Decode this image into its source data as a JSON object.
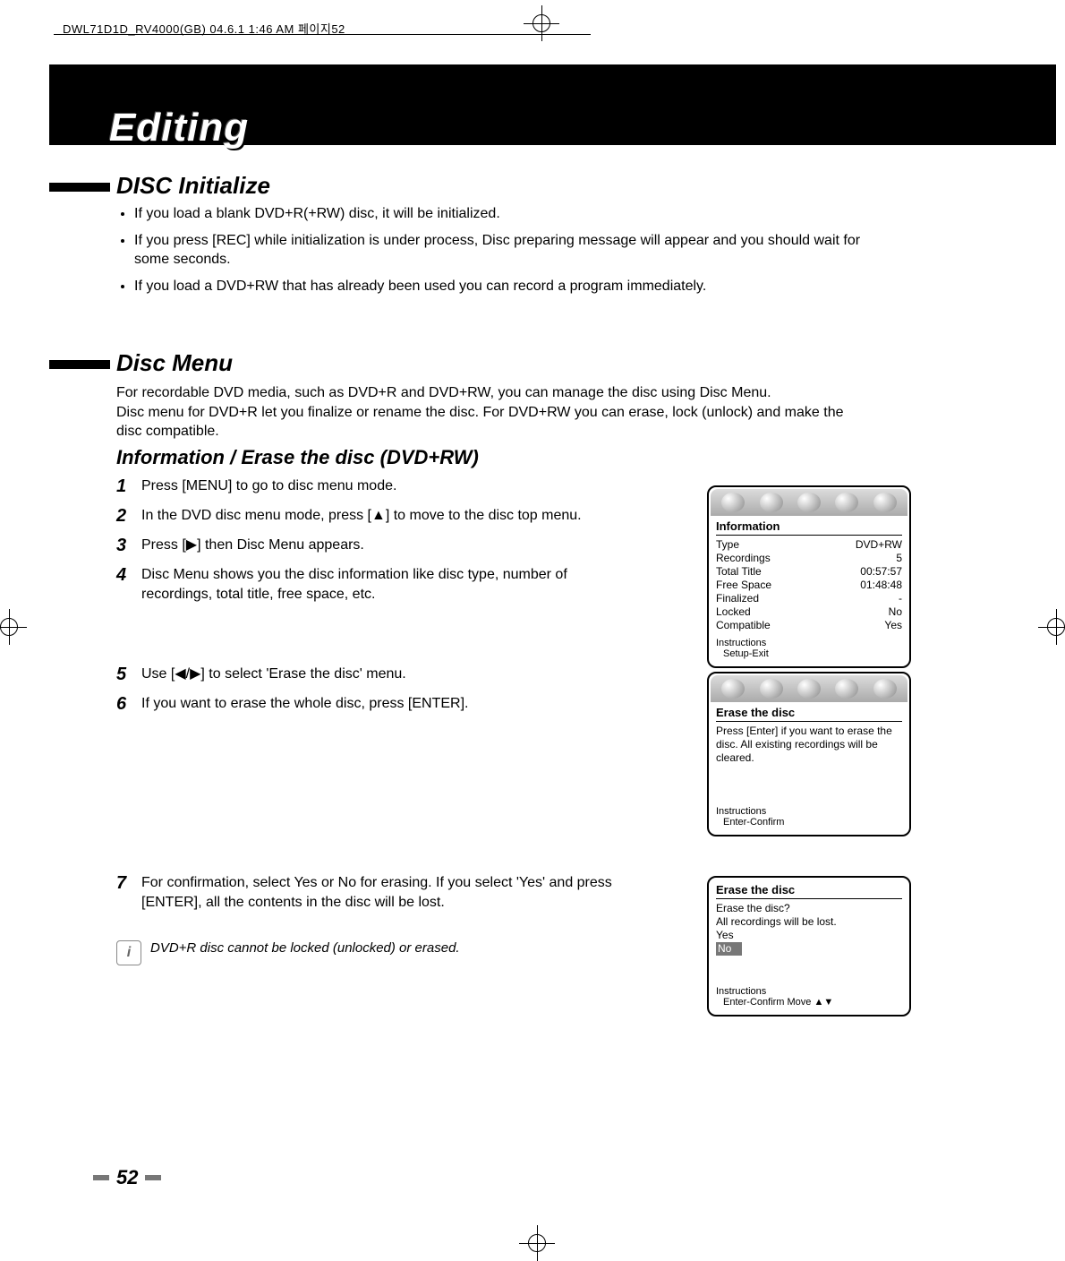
{
  "header_slug": "DWL71D1D_RV4000(GB)  04.6.1 1:46 AM  페이지52",
  "chapter_title": "Editing",
  "section_disc_init": "DISC Initialize",
  "disc_init_bullets": [
    "If you load a blank DVD+R(+RW) disc, it will be initialized.",
    "If you press [REC] while initialization is under process, Disc preparing message will appear and you should wait for some seconds.",
    "If you load a DVD+RW that has already been used you can record a program immediately."
  ],
  "section_disc_menu": "Disc Menu",
  "disc_menu_intro": "For recordable DVD media, such as DVD+R and DVD+RW, you can manage the disc using Disc Menu.\nDisc menu for DVD+R let you finalize or rename the disc. For DVD+RW you can erase, lock (unlock) and make the disc compatible.",
  "subheading_info_erase": "Information / Erase the disc  (DVD+RW)",
  "steps_a": [
    {
      "n": "1",
      "t": "Press [MENU] to go to disc menu mode."
    },
    {
      "n": "2",
      "t": "In the DVD disc menu mode,  press [▲] to move to the disc top menu."
    },
    {
      "n": "3",
      "t": "Press [▶] then Disc Menu appears."
    },
    {
      "n": "4",
      "t": "Disc Menu shows you the disc information like disc type, number of recordings, total title, free space, etc."
    }
  ],
  "steps_b": [
    {
      "n": "5",
      "t": "Use [◀/▶] to select 'Erase the disc' menu."
    },
    {
      "n": "6",
      "t": "If you want to erase the whole disc, press [ENTER]."
    }
  ],
  "steps_c": [
    {
      "n": "7",
      "t": "For confirmation, select Yes or No for erasing. If you select 'Yes' and press [ENTER], all the contents in the disc will be lost."
    }
  ],
  "note_text": "DVD+R disc cannot be locked (unlocked) or erased.",
  "osd1": {
    "title": "Information",
    "rows": [
      {
        "k": "Type",
        "v": "DVD+RW"
      },
      {
        "k": "Recordings",
        "v": "5"
      },
      {
        "k": "Total Title",
        "v": "00:57:57"
      },
      {
        "k": "Free Space",
        "v": "01:48:48"
      },
      {
        "k": "Finalized",
        "v": "-"
      },
      {
        "k": "Locked",
        "v": "No"
      },
      {
        "k": "Compatible",
        "v": "Yes"
      }
    ],
    "instr_label": "Instructions",
    "instr": "Setup-Exit"
  },
  "osd2": {
    "title": "Erase the disc",
    "body": "Press [Enter] if you want to erase the disc. All existing recordings will be cleared.",
    "instr_label": "Instructions",
    "instr": "Enter-Confirm"
  },
  "osd3": {
    "title": "Erase the disc",
    "line1": "Erase the disc?",
    "line2": "All recordings will be lost.",
    "opt_yes": "Yes",
    "opt_no": "No",
    "instr_label": "Instructions",
    "instr": "Enter-Confirm   Move ▲▼"
  },
  "page_number": "52"
}
